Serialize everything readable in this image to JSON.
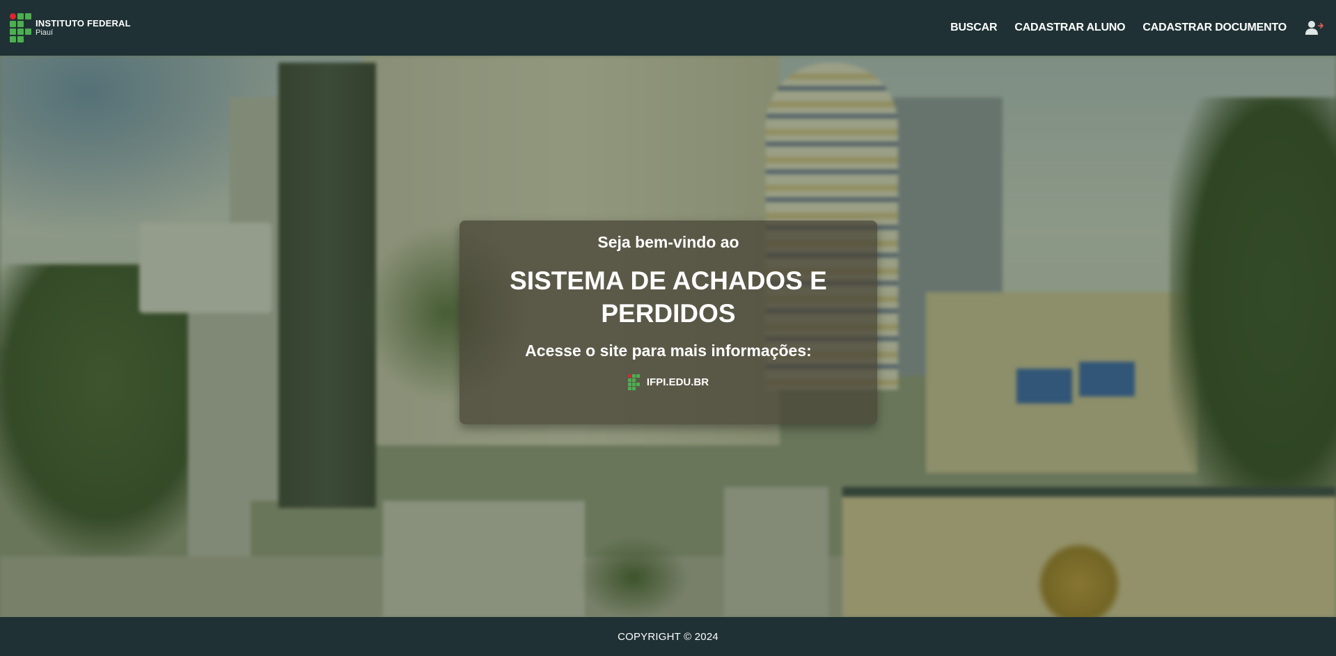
{
  "header": {
    "brand_name": "INSTITUTO FEDERAL",
    "brand_sub": "Piauí",
    "nav": [
      {
        "label": "BUSCAR"
      },
      {
        "label": "CADASTRAR ALUNO"
      },
      {
        "label": "CADASTRAR DOCUMENTO"
      }
    ],
    "user_icon": "user-logout-icon"
  },
  "hero": {
    "welcome": "Seja bem-vindo ao",
    "title": "SISTEMA DE ACHADOS E PERDIDOS",
    "subtitle": "Acesse o site para mais informações:",
    "site_label": "IFPI.EDU.BR"
  },
  "footer": {
    "copyright": "COPYRIGHT © 2024"
  },
  "colors": {
    "header_bg": "#1f3134",
    "brand_green": "#4caf50",
    "brand_red": "#e0242c"
  }
}
